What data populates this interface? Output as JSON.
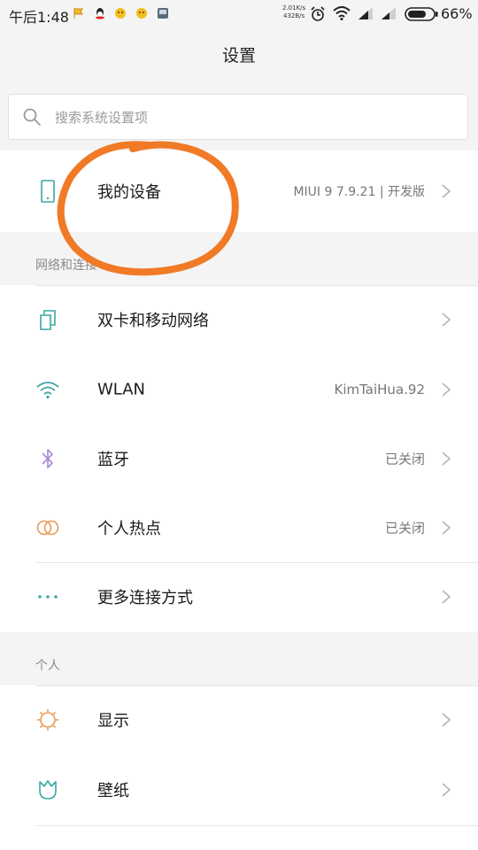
{
  "status_bar": {
    "time": "午后1:48",
    "speed_up": "2.01K/s",
    "speed_down": "432B/s",
    "battery": "66%"
  },
  "header": {
    "title": "设置"
  },
  "search": {
    "placeholder": "搜索系统设置项"
  },
  "device": {
    "label": "我的设备",
    "value": "MIUI 9 7.9.21 | 开发版",
    "icon": "phone-icon"
  },
  "network": {
    "heading": "网络和连接",
    "items": [
      {
        "label": "双卡和移动网络",
        "value": "",
        "icon": "sim-cards-icon"
      },
      {
        "label": "WLAN",
        "value": "KimTaiHua.92",
        "icon": "wifi-icon"
      },
      {
        "label": "蓝牙",
        "value": "已关闭",
        "icon": "bluetooth-icon"
      },
      {
        "label": "个人热点",
        "value": "已关闭",
        "icon": "hotspot-icon"
      },
      {
        "label": "更多连接方式",
        "value": "",
        "icon": "more-dots-icon"
      }
    ]
  },
  "personal": {
    "heading": "个人",
    "items": [
      {
        "label": "显示",
        "value": "",
        "icon": "display-brightness-icon"
      },
      {
        "label": "壁纸",
        "value": "",
        "icon": "wallpaper-icon"
      }
    ]
  },
  "colors": {
    "accent_icon": "#3aa8a0",
    "annotation": "#f07a25",
    "bluetooth": "#a88ad6",
    "hotspot": "#e89a55"
  }
}
